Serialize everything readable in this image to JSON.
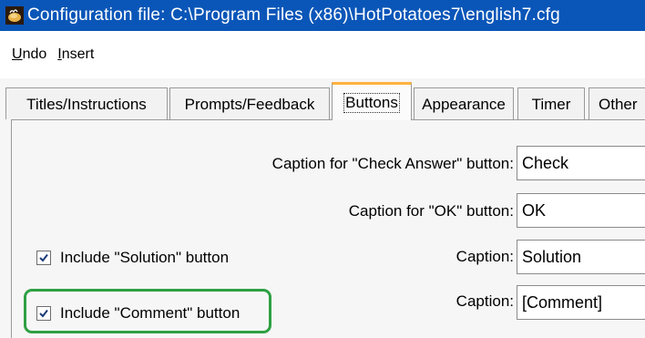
{
  "window": {
    "title": "Configuration file: C:\\Program Files (x86)\\HotPotatoes7\\english7.cfg",
    "icon": "hot-potatoes-app-icon"
  },
  "menu": {
    "undo": {
      "accel": "U",
      "rest": "ndo"
    },
    "insert": {
      "accel": "I",
      "rest": "nsert"
    }
  },
  "tabs": [
    {
      "label": "Titles/Instructions",
      "selected": false
    },
    {
      "label": "Prompts/Feedback",
      "selected": false
    },
    {
      "label": "Buttons",
      "selected": true
    },
    {
      "label": "Appearance",
      "selected": false
    },
    {
      "label": "Timer",
      "selected": false
    },
    {
      "label": "Other",
      "selected": false
    }
  ],
  "buttons_panel": {
    "check_answer": {
      "label": "Caption for \"Check Answer\" button:",
      "value": "Check"
    },
    "ok": {
      "label": "Caption for \"OK\" button:",
      "value": "OK"
    },
    "solution": {
      "checkbox_label": "Include \"Solution\" button",
      "checked": true,
      "caption_label": "Caption:",
      "value": "Solution"
    },
    "comment": {
      "checkbox_label": "Include \"Comment\" button",
      "checked": true,
      "caption_label": "Caption:",
      "value": "[Comment]"
    }
  },
  "colors": {
    "titlebar": "#0a56b8",
    "active_tab_accent": "#ffb23f",
    "highlight_border": "#2ea043"
  }
}
